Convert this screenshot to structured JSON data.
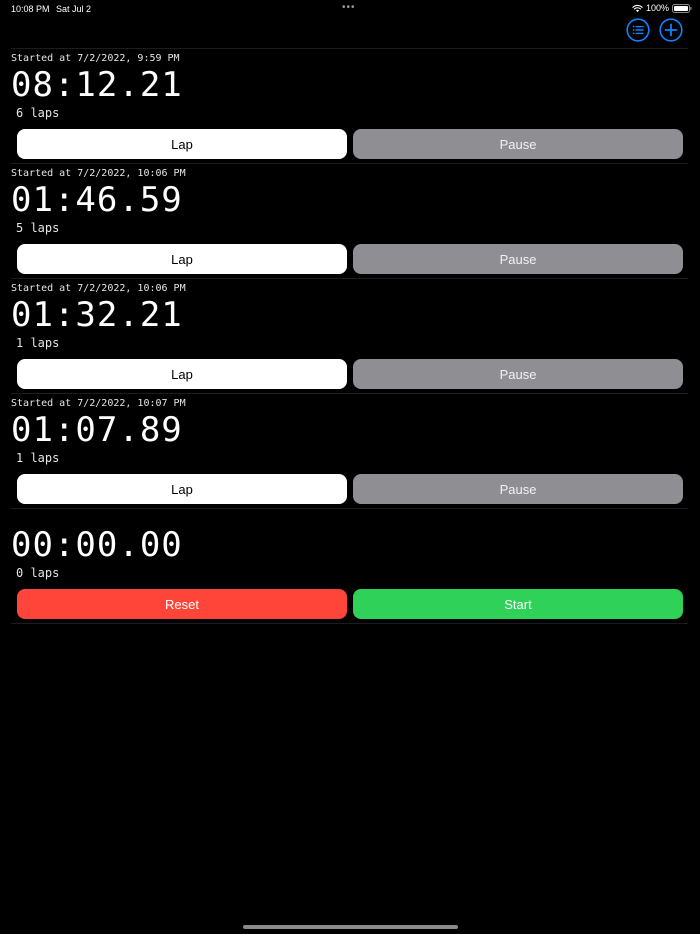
{
  "status_bar": {
    "time": "10:08 PM",
    "date": "Sat Jul 2",
    "battery": "100%",
    "multitask_dots": "•••"
  },
  "toolbar": {
    "list_icon": "list-icon",
    "add_icon": "plus-circle-icon"
  },
  "colors": {
    "accent": "#0a84ff",
    "lap_button": "#ffffff",
    "pause_button": "#8e8e93",
    "reset_button": "#ff453a",
    "start_button": "#30d158"
  },
  "timers": [
    {
      "started": "Started at 7/2/2022, 9:59 PM",
      "elapsed": "08:12.21",
      "laps": "6 laps",
      "left_button": "Lap",
      "right_button": "Pause"
    },
    {
      "started": "Started at 7/2/2022, 10:06 PM",
      "elapsed": "01:46.59",
      "laps": "5 laps",
      "left_button": "Lap",
      "right_button": "Pause"
    },
    {
      "started": "Started at 7/2/2022, 10:06 PM",
      "elapsed": "01:32.21",
      "laps": "1 laps",
      "left_button": "Lap",
      "right_button": "Pause"
    },
    {
      "started": "Started at 7/2/2022, 10:07 PM",
      "elapsed": "01:07.89",
      "laps": "1 laps",
      "left_button": "Lap",
      "right_button": "Pause"
    },
    {
      "started": "",
      "elapsed": "00:00.00",
      "laps": "0 laps",
      "left_button": "Reset",
      "right_button": "Start"
    }
  ]
}
